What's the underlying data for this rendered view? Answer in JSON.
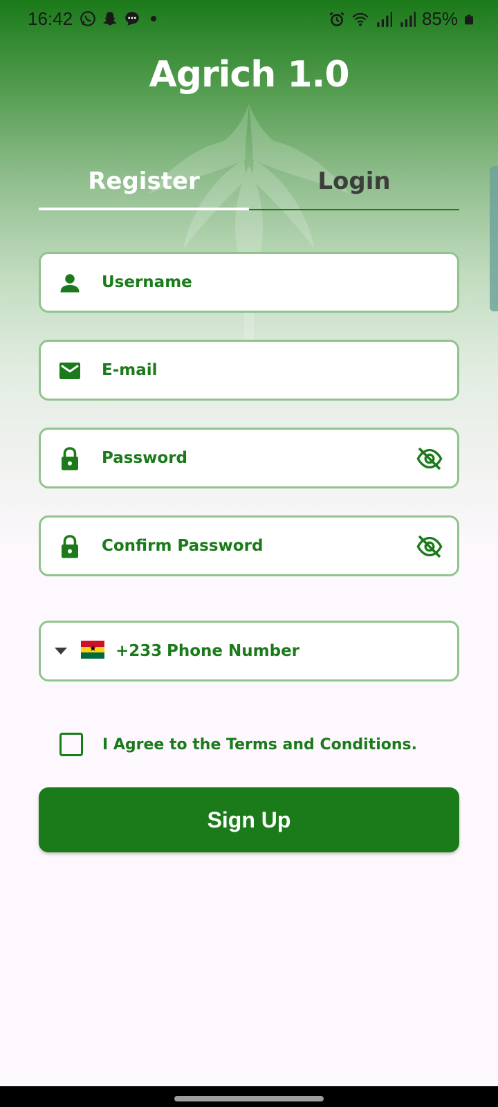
{
  "status_bar": {
    "time": "16:42",
    "battery": "85%",
    "icons": [
      "whatsapp-icon",
      "snapchat-icon",
      "message-icon",
      "alarm-icon",
      "wifi-icon",
      "signal-icon",
      "signal-icon",
      "battery-icon"
    ]
  },
  "app": {
    "title": "Agrich 1.0",
    "brand_color": "#1b7a1a"
  },
  "tabs": [
    {
      "label": "Register",
      "active": true
    },
    {
      "label": "Login",
      "active": false
    }
  ],
  "form": {
    "username_placeholder": "Username",
    "email_placeholder": "E-mail",
    "password_placeholder": "Password",
    "confirm_password_placeholder": "Confirm Password",
    "phone": {
      "country_code": "+233",
      "placeholder": "Phone Number",
      "flag": "ghana-flag"
    },
    "terms_label": "I Agree to the Terms and Conditions.",
    "terms_checked": false,
    "submit_label": "Sign Up"
  }
}
